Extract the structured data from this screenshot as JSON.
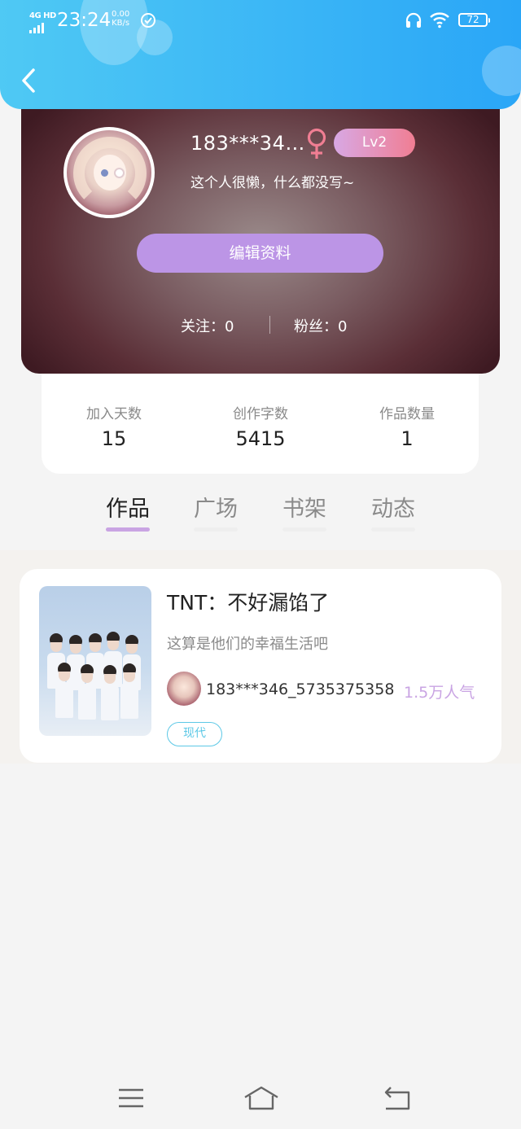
{
  "status_bar": {
    "network": "4G HD",
    "time": "23:24",
    "speed_value": "0.00",
    "speed_unit": "KB/s",
    "battery": "72"
  },
  "icons": {
    "back": "chevron-left-icon",
    "gender": "female-symbol-icon",
    "menu": "menu-icon",
    "home": "home-icon",
    "return": "return-icon"
  },
  "profile": {
    "username": "183***34…",
    "level": "Lv2",
    "bio": "这个人很懒，什么都没写~",
    "edit_label": "编辑资料",
    "following_label": "关注：",
    "following_count": "0",
    "fans_label": "粉丝：",
    "fans_count": "0"
  },
  "stats": [
    {
      "label": "加入天数",
      "value": "15"
    },
    {
      "label": "创作字数",
      "value": "5415"
    },
    {
      "label": "作品数量",
      "value": "1"
    }
  ],
  "tabs": [
    {
      "label": "作品",
      "active": true
    },
    {
      "label": "广场",
      "active": false
    },
    {
      "label": "书架",
      "active": false
    },
    {
      "label": "动态",
      "active": false
    }
  ],
  "works": [
    {
      "title": "TNT：不好漏馅了",
      "description": "这算是他们的幸福生活吧",
      "author": "183***346_5735375358",
      "popularity": "1.5万人气",
      "tag": "现代"
    }
  ],
  "colors": {
    "header_start": "#4fc9f4",
    "header_end": "#2aa6f7",
    "accent_purple": "#bc95e6",
    "level_pink": "#f07e93",
    "gender_pink": "#f07e93",
    "tag_cyan": "#5cc8e6"
  }
}
